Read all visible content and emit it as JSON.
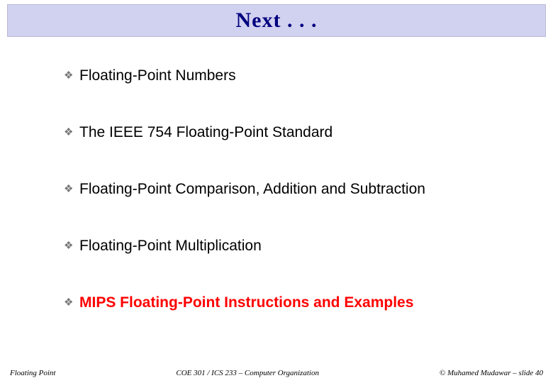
{
  "title": "Next . . .",
  "items": [
    {
      "label": "Floating-Point Numbers",
      "active": false
    },
    {
      "label": "The IEEE 754 Floating-Point Standard",
      "active": false
    },
    {
      "label": "Floating-Point Comparison, Addition and Subtraction",
      "active": false
    },
    {
      "label": "Floating-Point Multiplication",
      "active": false
    },
    {
      "label": "MIPS Floating-Point Instructions and Examples",
      "active": true
    }
  ],
  "footer": {
    "left": "Floating Point",
    "center": "COE 301 / ICS 233 – Computer Organization",
    "right": "© Muhamed Mudawar – slide 40"
  },
  "bullet_glyph": "❖"
}
